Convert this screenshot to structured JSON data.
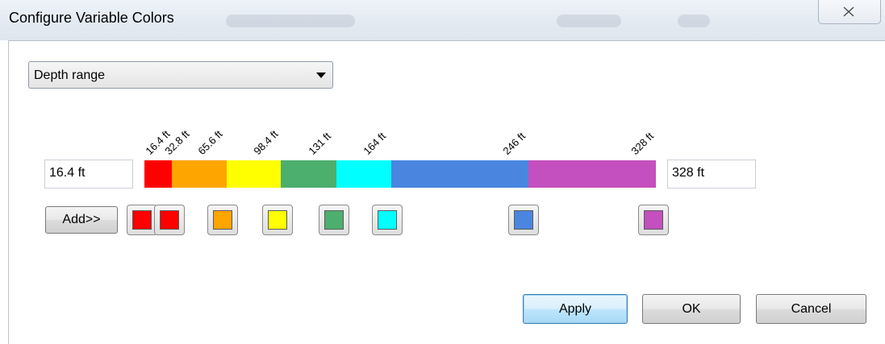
{
  "window": {
    "title": "Configure Variable Colors"
  },
  "variable_select": {
    "value": "Depth range"
  },
  "range": {
    "min_value": "16.4 ft",
    "max_value": "328 ft"
  },
  "tick_labels": [
    "16.4 ft",
    "32.8 ft",
    "65.6 ft",
    "98.4 ft",
    "131 ft",
    "164 ft",
    "246 ft",
    "328 ft"
  ],
  "color_bands": [
    {
      "color": "#ff0000"
    },
    {
      "color": "#ffa500"
    },
    {
      "color": "#ffff00"
    },
    {
      "color": "#4caf6e"
    },
    {
      "color": "#00ffff"
    },
    {
      "color": "#4a86e0"
    },
    {
      "color": "#c44fbe"
    }
  ],
  "swatches": [
    {
      "color": "#ff0000"
    },
    {
      "color": "#ff0000"
    },
    {
      "color": "#ffa500"
    },
    {
      "color": "#ffff00"
    },
    {
      "color": "#4caf6e"
    },
    {
      "color": "#00ffff"
    },
    {
      "color": "#4a86e0"
    },
    {
      "color": "#c44fbe"
    }
  ],
  "buttons": {
    "add": "Add>>",
    "apply": "Apply",
    "ok": "OK",
    "cancel": "Cancel"
  },
  "icons": {
    "close": "close-icon",
    "dropdown_arrow": "chevron-down-icon"
  }
}
